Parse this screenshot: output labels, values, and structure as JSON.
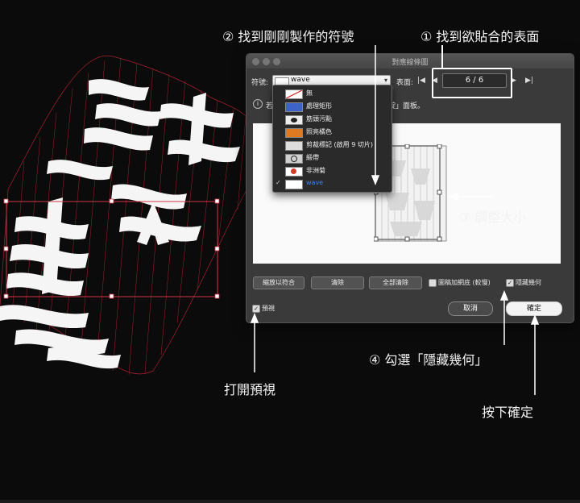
{
  "dialog": {
    "title": "對應線條圖",
    "symbol_label": "符號:",
    "symbol_value": "wave",
    "surface_label": "表面:",
    "surface_value": "6 / 6",
    "first_icon": "first-page-icon",
    "prev_icon": "previous-page-icon",
    "next_icon": "next-page-icon",
    "last_icon": "last-page-icon",
    "info_fragment_left": "若",
    "info_fragment_right": "靛」面板。",
    "buttons": {
      "scale_to_fit": "縮放以符合",
      "clear": "清除",
      "clear_all": "全部清除",
      "cancel": "取消",
      "ok": "確定"
    },
    "checkboxes": {
      "shade_artwork": {
        "label": "圖稿加網底 (較慢)",
        "checked": false
      },
      "invisible_geometry": {
        "label": "隱藏幾何",
        "checked": true
      },
      "preview": {
        "label": "預視",
        "checked": true
      }
    }
  },
  "dropdown": {
    "items": [
      {
        "label": "無",
        "swatch": "#ffffff",
        "icon": "none-slash-icon"
      },
      {
        "label": "處理矩形",
        "swatch": "#3b63c8",
        "icon": "rectangle-swatch-icon"
      },
      {
        "label": "筋頭污點",
        "swatch": "#222222",
        "icon": "splatter-swatch-icon"
      },
      {
        "label": "照亮橘色",
        "swatch": "#e07a20",
        "icon": "orange-swatch-icon"
      },
      {
        "label": "剪裁標記 (啟用 9 切片)",
        "swatch": "#dddddd",
        "icon": "crop-mark-icon"
      },
      {
        "label": "緞帶",
        "swatch": "#cfcfcf",
        "icon": "ribbon-icon"
      },
      {
        "label": "非洲菊",
        "swatch": "#d83a2a",
        "icon": "gerbera-icon"
      },
      {
        "label": "wave",
        "swatch": "#ffffff",
        "icon": "wave-swatch-icon",
        "selected": true
      }
    ]
  },
  "annotations": {
    "step1": "① 找到欲貼合的表面",
    "step2": "② 找到剛剛製作的符號",
    "step3": "③ 調整大小",
    "step4": "④ 勾選「隱藏幾何」",
    "open_preview": "打開預視",
    "press_ok": "按下確定"
  },
  "colors": {
    "accent": "#3b82f6",
    "wireframe": "#c0243a",
    "background": "#0b0b0b"
  }
}
